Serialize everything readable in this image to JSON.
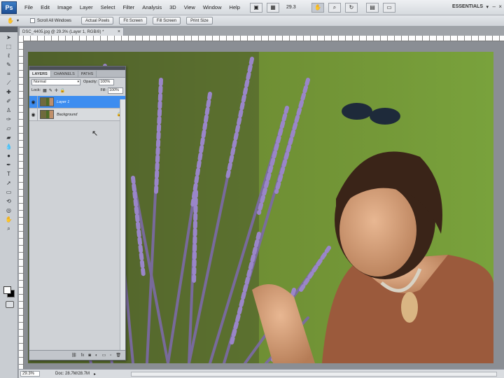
{
  "app": {
    "logo": "Ps",
    "menu": [
      "File",
      "Edit",
      "Image",
      "Layer",
      "Select",
      "Filter",
      "Analysis",
      "3D",
      "View",
      "Window",
      "Help"
    ],
    "zoom": "29.3",
    "workspace": "ESSENTIALS"
  },
  "options_bar": {
    "scroll_all_windows": "Scroll All Windows",
    "buttons": [
      "Actual Pixels",
      "Fit Screen",
      "Fill Screen",
      "Print Size"
    ]
  },
  "document": {
    "tab_title": "DSC_4405.jpg @ 29.3% (Layer 1, RGB/8) *",
    "close": "×"
  },
  "layers_panel": {
    "tabs": [
      "Layers",
      "Channels",
      "Paths"
    ],
    "blend_mode": "Normal",
    "opacity_label": "Opacity:",
    "opacity_value": "100%",
    "lock_label": "Lock:",
    "fill_label": "Fill:",
    "fill_value": "100%",
    "layers": [
      {
        "name": "Layer 1",
        "selected": true
      },
      {
        "name": "Background",
        "selected": false,
        "locked": true
      }
    ]
  },
  "status_bar": {
    "zoom": "29.3%",
    "doc_info": "Doc: 28.7M/28.7M"
  },
  "colors": {
    "selection_blue": "#3d8df0",
    "foreground": "#ffffff",
    "background": "#000000"
  }
}
